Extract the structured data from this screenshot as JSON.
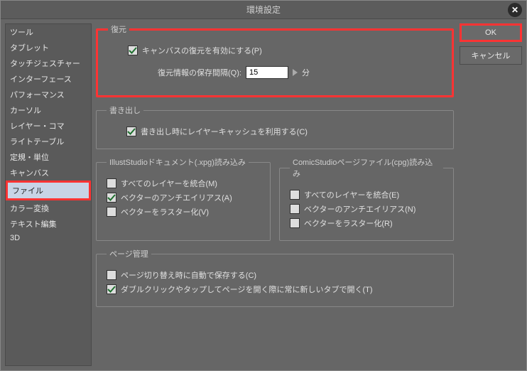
{
  "title": "環境設定",
  "buttons": {
    "ok": "OK",
    "cancel": "キャンセル"
  },
  "sidebar": {
    "items": [
      "ツール",
      "タブレット",
      "タッチジェスチャー",
      "インターフェース",
      "パフォーマンス",
      "カーソル",
      "レイヤー・コマ",
      "ライトテーブル",
      "定規・単位",
      "キャンバス",
      "ファイル",
      "カラー変換",
      "テキスト編集",
      "3D"
    ],
    "selectedIndex": 10
  },
  "restore": {
    "legend": "復元",
    "enable": "キャンバスの復元を有効にする(P)",
    "intervalLabel": "復元情報の保存間隔(Q):",
    "intervalValue": "15",
    "unit": "分"
  },
  "export": {
    "legend": "書き出し",
    "cache": "書き出し時にレイヤーキャッシュを利用する(C)"
  },
  "illust": {
    "legend": "IllustStudioドキュメント(.xpg)読み込み",
    "merge": "すべてのレイヤーを統合(M)",
    "vecAA": "ベクターのアンチエイリアス(A)",
    "vecRaster": "ベクターをラスター化(V)"
  },
  "comic": {
    "legend": "ComicStudioページファイル(cpg)読み込み",
    "merge": "すべてのレイヤーを統合(E)",
    "vecAA": "ベクターのアンチエイリアス(N)",
    "vecRaster": "ベクターをラスター化(R)"
  },
  "page": {
    "legend": "ページ管理",
    "autosave": "ページ切り替え時に自動で保存する(C)",
    "newtab": "ダブルクリックやタップしてページを開く際に常に新しいタブで開く(T)"
  }
}
